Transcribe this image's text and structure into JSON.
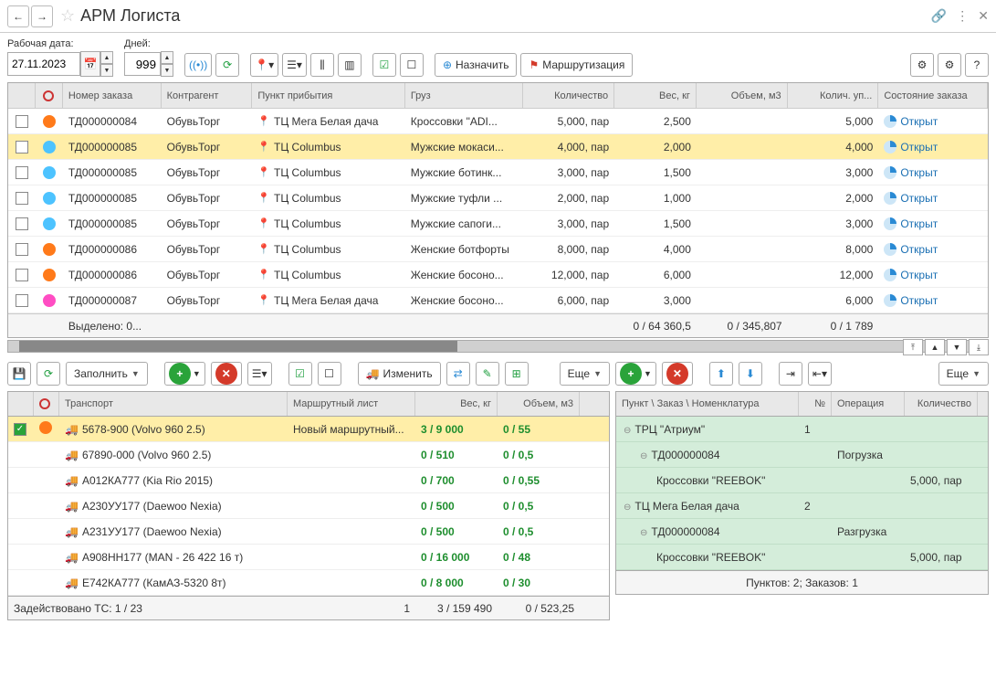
{
  "title": "АРМ Логиста",
  "labels": {
    "work_date": "Рабочая дата:",
    "days": "Дней:"
  },
  "work_date": "27.11.2023",
  "days": "999",
  "toolbar": {
    "assign": "Назначить",
    "routing": "Маршрутизация"
  },
  "orders_header": {
    "order": "Номер заказа",
    "contractor": "Контрагент",
    "destination": "Пункт прибытия",
    "cargo": "Груз",
    "qty": "Количество",
    "weight": "Вес, кг",
    "volume": "Объем, м3",
    "packages": "Колич. уп...",
    "state": "Состояние заказа"
  },
  "orders": [
    {
      "dot": "orange",
      "order": "ТД000000084",
      "contractor": "ОбувьТорг",
      "dest": "ТЦ Мега Белая дача",
      "cargo": "Кроссовки \"ADI...",
      "qty": "5,000, пар",
      "weight": "2,500",
      "pkg": "5,000",
      "state": "Открыт",
      "sel": false
    },
    {
      "dot": "blue",
      "order": "ТД000000085",
      "contractor": "ОбувьТорг",
      "dest": "ТЦ Columbus",
      "cargo": "Мужские мокаси...",
      "qty": "4,000, пар",
      "weight": "2,000",
      "pkg": "4,000",
      "state": "Открыт",
      "sel": true
    },
    {
      "dot": "blue",
      "order": "ТД000000085",
      "contractor": "ОбувьТорг",
      "dest": "ТЦ Columbus",
      "cargo": "Мужские ботинк...",
      "qty": "3,000, пар",
      "weight": "1,500",
      "pkg": "3,000",
      "state": "Открыт",
      "sel": false
    },
    {
      "dot": "blue",
      "order": "ТД000000085",
      "contractor": "ОбувьТорг",
      "dest": "ТЦ Columbus",
      "cargo": "Мужские туфли ...",
      "qty": "2,000, пар",
      "weight": "1,000",
      "pkg": "2,000",
      "state": "Открыт",
      "sel": false
    },
    {
      "dot": "blue",
      "order": "ТД000000085",
      "contractor": "ОбувьТорг",
      "dest": "ТЦ Columbus",
      "cargo": "Мужские сапоги...",
      "qty": "3,000, пар",
      "weight": "1,500",
      "pkg": "3,000",
      "state": "Открыт",
      "sel": false
    },
    {
      "dot": "orange",
      "order": "ТД000000086",
      "contractor": "ОбувьТорг",
      "dest": "ТЦ Columbus",
      "cargo": "Женские ботфорты",
      "qty": "8,000, пар",
      "weight": "4,000",
      "pkg": "8,000",
      "state": "Открыт",
      "sel": false
    },
    {
      "dot": "orange",
      "order": "ТД000000086",
      "contractor": "ОбувьТорг",
      "dest": "ТЦ Columbus",
      "cargo": "Женские босоно...",
      "qty": "12,000, пар",
      "weight": "6,000",
      "pkg": "12,000",
      "state": "Открыт",
      "sel": false
    },
    {
      "dot": "pink",
      "order": "ТД000000087",
      "contractor": "ОбувьТорг",
      "dest": "ТЦ Мега Белая дача",
      "cargo": "Женские босоно...",
      "qty": "6,000, пар",
      "weight": "3,000",
      "pkg": "6,000",
      "state": "Открыт",
      "sel": false
    }
  ],
  "orders_footer": {
    "selected": "Выделено: 0...",
    "weight": "0 / 64 360,5",
    "volume": "0 / 345,807",
    "packages": "0 / 1 789"
  },
  "lower_toolbar": {
    "fill": "Заполнить",
    "change": "Изменить",
    "more": "Еще",
    "more2": "Еще"
  },
  "transport_header": {
    "transport": "Транспорт",
    "route": "Маршрутный лист",
    "weight": "Вес, кг",
    "volume": "Объем, м3"
  },
  "transport": [
    {
      "chk": true,
      "dot": "orange",
      "label": "5678-900 (Volvo 960 2.5)",
      "route": "Новый маршрутный...",
      "weight": "3 / 9 000",
      "vol": "0 / 55",
      "sel": true
    },
    {
      "chk": false,
      "dot": "",
      "label": "67890-000 (Volvo 960 2.5)",
      "route": "",
      "weight": "0 / 510",
      "vol": "0 / 0,5",
      "sel": false
    },
    {
      "chk": false,
      "dot": "",
      "label": "А012КА777 (Kia Rio 2015)",
      "route": "",
      "weight": "0 / 700",
      "vol": "0 / 0,55",
      "sel": false
    },
    {
      "chk": false,
      "dot": "",
      "label": "А230УУ177 (Daewoo Nexia)",
      "route": "",
      "weight": "0 / 500",
      "vol": "0 / 0,5",
      "sel": false
    },
    {
      "chk": false,
      "dot": "",
      "label": "А231УУ177 (Daewoo Nexia)",
      "route": "",
      "weight": "0 / 500",
      "vol": "0 / 0,5",
      "sel": false
    },
    {
      "chk": false,
      "dot": "",
      "label": "А908НН177 (MAN - 26 422  16 т)",
      "route": "",
      "weight": "0 / 16 000",
      "vol": "0 / 48",
      "sel": false
    },
    {
      "chk": false,
      "dot": "",
      "label": "Е742КА777 (КамАЗ-5320 8т)",
      "route": "",
      "weight": "0 / 8 000",
      "vol": "0 / 30",
      "sel": false
    }
  ],
  "transport_footer": {
    "used": "Задействовано ТС: 1 / 23",
    "count": "1",
    "weight": "3 / 159 490",
    "vol": "0 / 523,25"
  },
  "route_header": {
    "node": "Пункт \\ Заказ \\ Номенклатура",
    "num": "№",
    "op": "Операция",
    "qty": "Количество"
  },
  "route_tree": [
    {
      "indent": 0,
      "label": "ТРЦ \"Атриум\"",
      "num": "1",
      "op": "",
      "qty": ""
    },
    {
      "indent": 1,
      "label": "ТД000000084",
      "num": "",
      "op": "Погрузка",
      "qty": ""
    },
    {
      "indent": 2,
      "label": "Кроссовки \"REEBOK\"",
      "num": "",
      "op": "",
      "qty": "5,000, пар"
    },
    {
      "indent": 0,
      "label": "ТЦ Мега Белая дача",
      "num": "2",
      "op": "",
      "qty": ""
    },
    {
      "indent": 1,
      "label": "ТД000000084",
      "num": "",
      "op": "Разгрузка",
      "qty": ""
    },
    {
      "indent": 2,
      "label": "Кроссовки \"REEBOK\"",
      "num": "",
      "op": "",
      "qty": "5,000, пар"
    }
  ],
  "route_footer": "Пунктов: 2; Заказов: 1"
}
